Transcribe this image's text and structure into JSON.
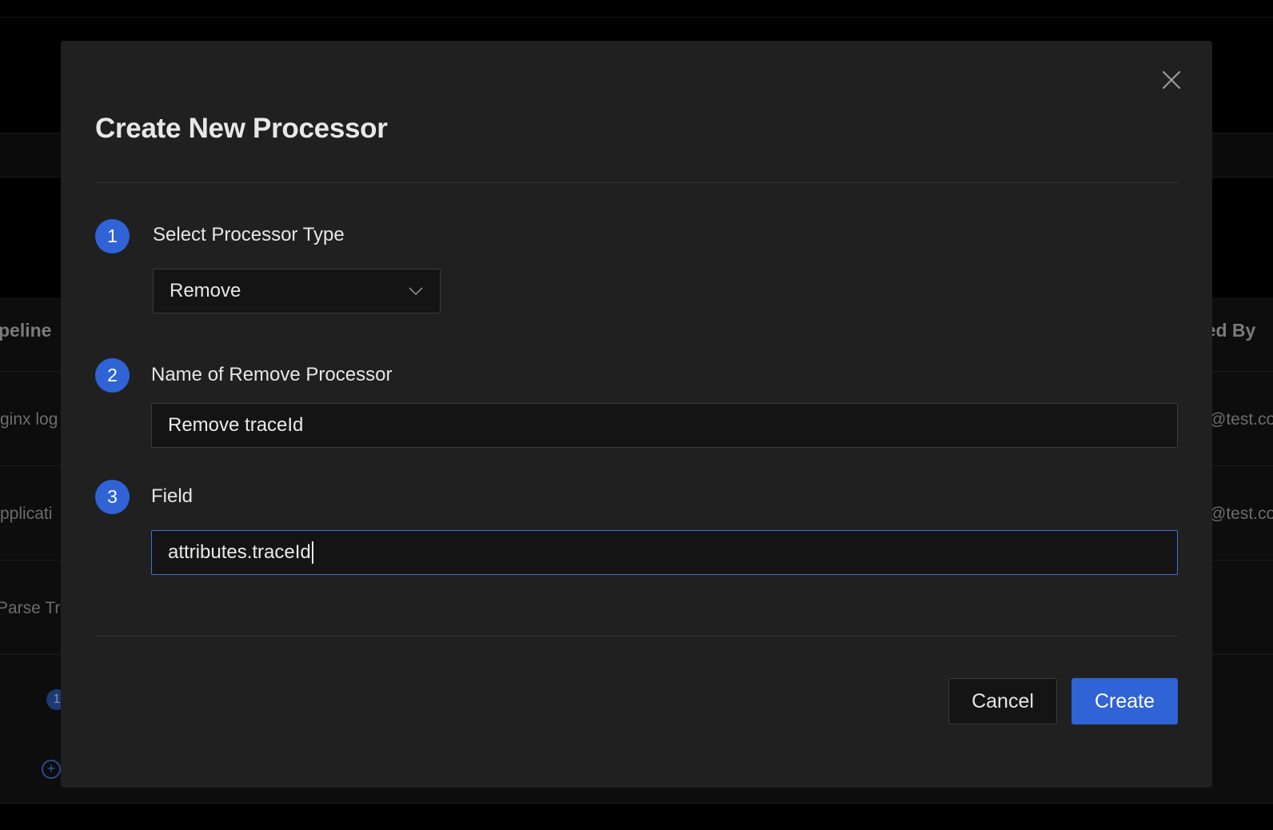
{
  "background": {
    "table_headers": {
      "left": "peline",
      "right": "ted By"
    },
    "rows": [
      {
        "name": "ginx log",
        "created_by": "@test.co"
      },
      {
        "name": "pplicati",
        "created_by": "@test.co"
      },
      {
        "name": "Parse Tra",
        "created_by": ""
      }
    ],
    "badge": "1",
    "add_symbol": "+"
  },
  "modal": {
    "title": "Create New Processor",
    "close_label": "×",
    "steps": [
      {
        "number": "1",
        "label": "Select Processor Type"
      },
      {
        "number": "2",
        "label": "Name of Remove Processor"
      },
      {
        "number": "3",
        "label": "Field"
      }
    ],
    "processor_type": {
      "selected": "Remove"
    },
    "name_input": {
      "value": "Remove traceId"
    },
    "field_input": {
      "value": "attributes.traceId"
    },
    "buttons": {
      "cancel": "Cancel",
      "create": "Create"
    }
  },
  "colors": {
    "accent": "#2f63d6",
    "modal_bg": "#202021",
    "input_bg": "#141414",
    "focus_border": "#3f6fd8"
  }
}
